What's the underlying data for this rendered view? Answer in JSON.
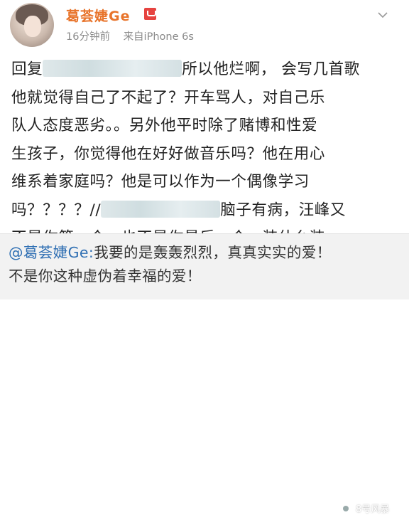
{
  "post": {
    "username": "葛荟婕Ge",
    "time": "16分钟前",
    "source": "来自iPhone 6s",
    "lines": [
      {
        "pre": "回复",
        "post": "所以他烂啊， 会写几首歌"
      },
      {
        "text": "他就觉得自己了不起了？开车骂人，对自己乐"
      },
      {
        "text": "队人态度恶劣。。另外他平时除了赌博和性爱"
      },
      {
        "text": "生孩子，你觉得他在好好做音乐吗？他在用心"
      },
      {
        "text": "维系着家庭吗？他是可以作为一个偶像学习"
      },
      {
        "pre": "吗？？？？//",
        "post": "脑子有病，汪峰又"
      },
      {
        "text": "不是你第一个，也不是你最后一个，装什么装"
      }
    ]
  },
  "quote": {
    "mention": "@葛荟婕Ge:",
    "line1": "我要的是轰轰烈烈，真真实实的爱！",
    "line2": "不是你这种虚伪着幸福的爱！"
  },
  "watermark": {
    "text": "8号风暴"
  },
  "colors": {
    "username": "#e8742b",
    "mention": "#2f6fb3",
    "quote_bg": "#f2f2f2"
  }
}
